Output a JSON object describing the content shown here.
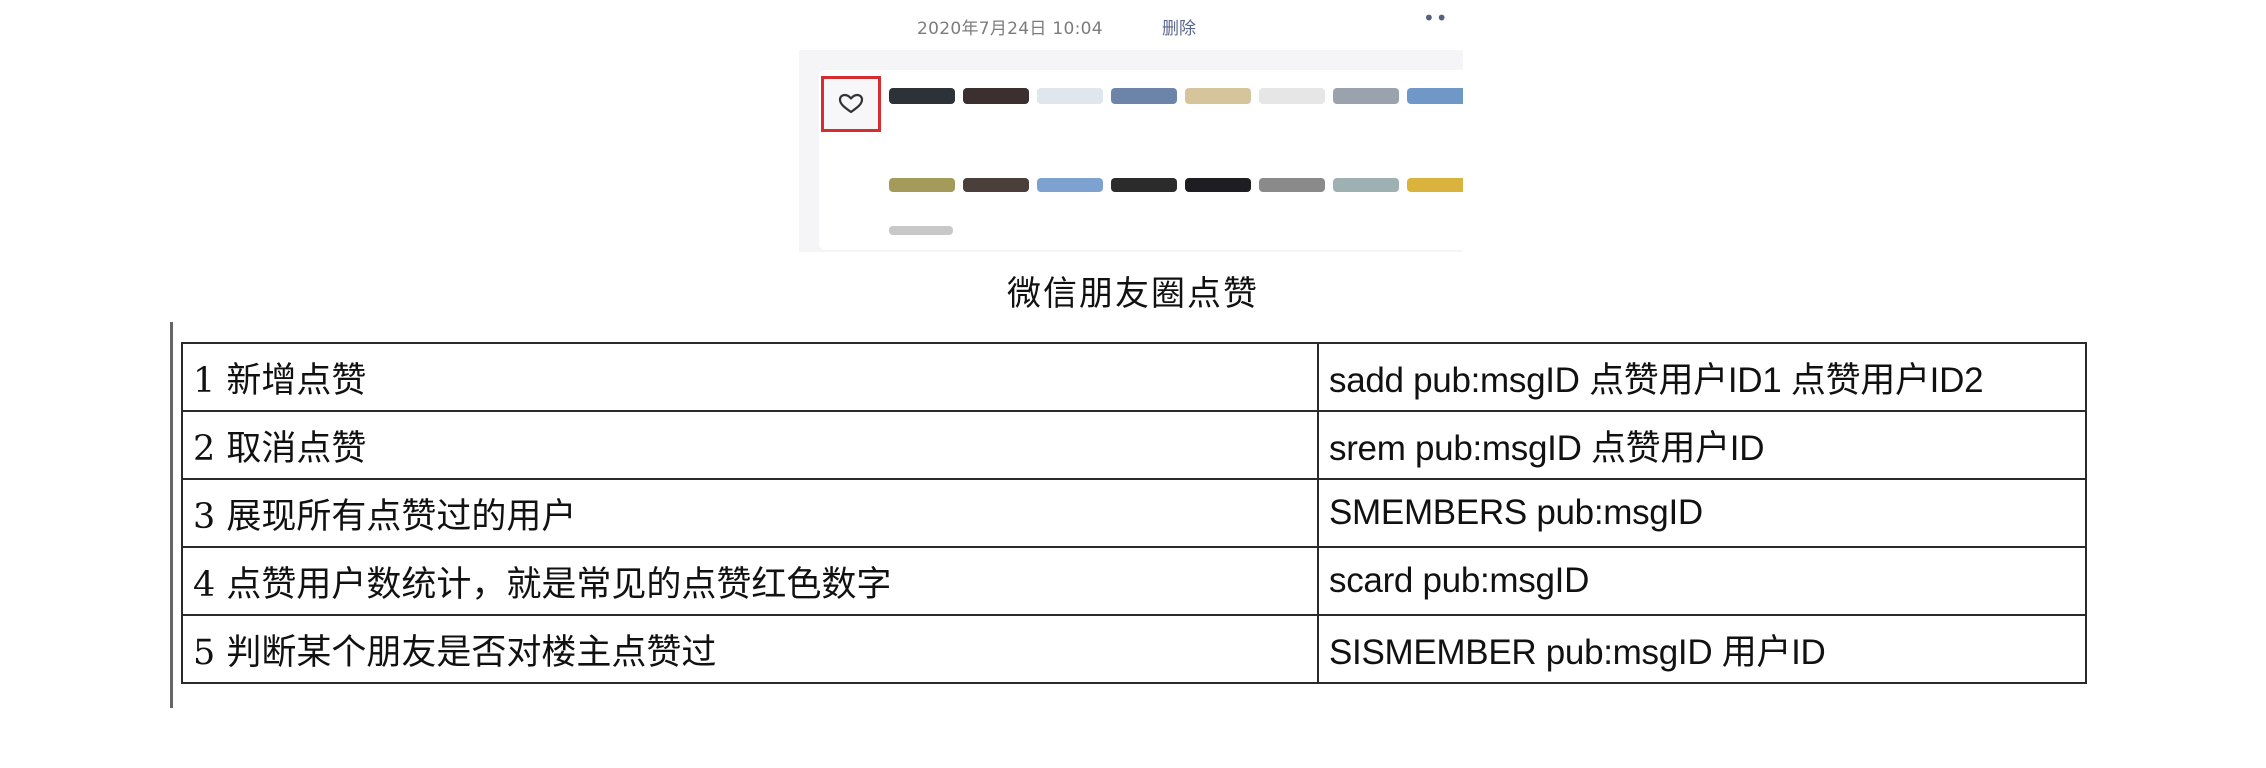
{
  "post": {
    "timestamp": "2020年7月24日 10:04",
    "delete_label": "删除",
    "more_label": "••"
  },
  "like_icon": "heart-outline-icon",
  "avatar_rows": [
    [
      "#2d3138",
      "#3b2f30",
      "#dfe6ee",
      "#6c84a8",
      "#d8c49a",
      "#e6e6e6",
      "#9aa3ad",
      "#6f97c7"
    ],
    [
      "#a49a5a",
      "#4a3f3a",
      "#7ea2cf",
      "#2b2b2b",
      "#1e1e22",
      "#8a8a8a",
      "#9fb0b2",
      "#d9b33b"
    ]
  ],
  "caption": "微信朋友圈点赞",
  "table": {
    "rows": [
      {
        "description": "1 新增点赞",
        "command": "sadd pub:msgID  点赞用户ID1  点赞用户ID2"
      },
      {
        "description": "2 取消点赞",
        "command": "srem pub:msgID  点赞用户ID"
      },
      {
        "description": "3 展现所有点赞过的用户",
        "command": "SMEMBERS  pub:msgID"
      },
      {
        "description": "4 点赞用户数统计，就是常见的点赞红色数字",
        "command": "scard  pub:msgID"
      },
      {
        "description": "5 判断某个朋友是否对楼主点赞过",
        "command": "SISMEMBER pub:msgID 用户ID"
      }
    ]
  }
}
